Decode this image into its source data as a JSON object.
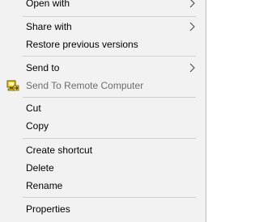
{
  "context_menu": {
    "items": {
      "open_with": "Open with",
      "share_with": "Share with",
      "restore_previous_versions": "Restore previous versions",
      "send_to": "Send to",
      "send_to_remote_computer": "Send To Remote Computer",
      "cut": "Cut",
      "copy": "Copy",
      "create_shortcut": "Create shortcut",
      "delete": "Delete",
      "rename": "Rename",
      "properties": "Properties"
    },
    "icons": {
      "submenu": "chevron-right-icon",
      "remote_computer": "remote-computer-icon"
    },
    "colors": {
      "background": "#f2f2f2",
      "separator": "#cfcfcf",
      "disabled_text": "#6d6d6d",
      "icon_yellow": "#f2c811"
    }
  }
}
